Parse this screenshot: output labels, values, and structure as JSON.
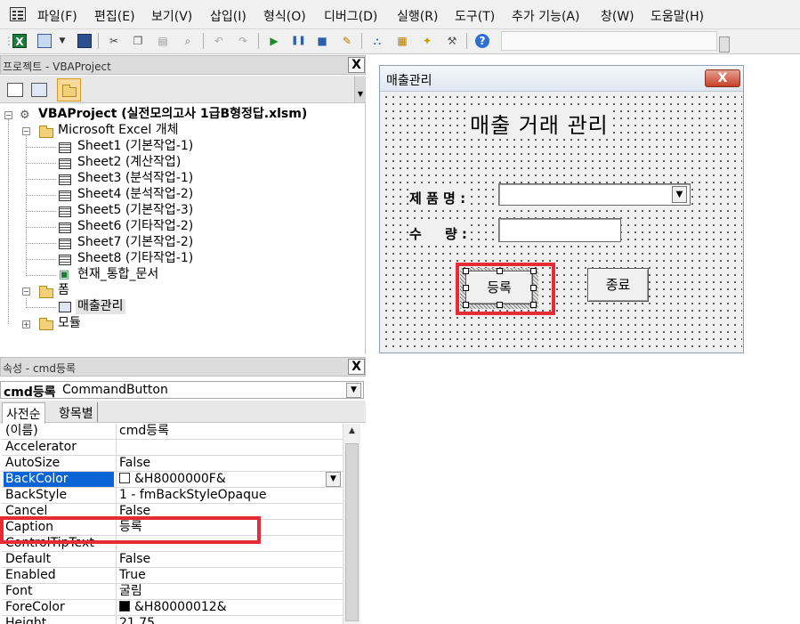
{
  "menu": {
    "items": [
      "파일(F)",
      "편집(E)",
      "보기(V)",
      "삽입(I)",
      "형식(O)",
      "디버그(D)",
      "실행(R)",
      "도구(T)",
      "추가 기능(A)",
      "창(W)",
      "도움말(H)"
    ]
  },
  "toolbar": {
    "icons": [
      "excel-icon",
      "insert-userform-icon",
      "save-icon",
      "cut-icon",
      "copy-icon",
      "paste-icon",
      "find-icon",
      "undo-icon",
      "redo-icon",
      "run-icon",
      "break-icon",
      "reset-icon",
      "design-mode-icon",
      "project-explorer-icon",
      "properties-icon",
      "object-browser-icon",
      "toolbox-icon",
      "help-icon"
    ]
  },
  "project_panel": {
    "title": "프로젝트 - VBAProject",
    "close": "X",
    "tree": {
      "root": "VBAProject (실전모의고사 1급B형정답.xlsm)",
      "excel_objects_folder": "Microsoft Excel 개체",
      "sheets": [
        "Sheet1 (기본작업-1)",
        "Sheet2 (계산작업)",
        "Sheet3 (분석작업-1)",
        "Sheet4 (분석작업-2)",
        "Sheet5 (기본작업-3)",
        "Sheet6 (기타작업-2)",
        "Sheet7 (기본작업-2)",
        "Sheet8 (기타작업-1)"
      ],
      "workbook": "현재_통합_문서",
      "forms_folder": "폼",
      "form": "매출관리",
      "modules_folder": "모듈"
    }
  },
  "properties_panel": {
    "title": "속성 - cmd등록",
    "close": "X",
    "object_name": "cmd등록",
    "object_type": "CommandButton",
    "tabs": [
      "사전순",
      "항목별"
    ],
    "rows": [
      {
        "name": "(이름)",
        "value": "cmd등록"
      },
      {
        "name": "Accelerator",
        "value": ""
      },
      {
        "name": "AutoSize",
        "value": "False"
      },
      {
        "name": "BackColor",
        "value": "&H8000000F&"
      },
      {
        "name": "BackStyle",
        "value": "1 - fmBackStyleOpaque"
      },
      {
        "name": "Cancel",
        "value": "False"
      },
      {
        "name": "Caption",
        "value": "등록"
      },
      {
        "name": "ControlTipText",
        "value": ""
      },
      {
        "name": "Default",
        "value": "False"
      },
      {
        "name": "Enabled",
        "value": "True"
      },
      {
        "name": "Font",
        "value": "굴림"
      },
      {
        "name": "ForeColor",
        "value": "&H80000012&"
      },
      {
        "name": "Height",
        "value": "21.75"
      }
    ],
    "colors": {
      "backcolor_swatch": "#ffffff",
      "forecolor_swatch": "#000000",
      "selected_row": "#0a64d6"
    }
  },
  "userform": {
    "window_title": "매출관리",
    "close": "X",
    "heading": "매출 거래 관리",
    "product_label": "제 품 명 :",
    "qty_label": "수     량 :",
    "register_button": "등록",
    "exit_button": "종료"
  },
  "highlight_color": "#e52b34"
}
